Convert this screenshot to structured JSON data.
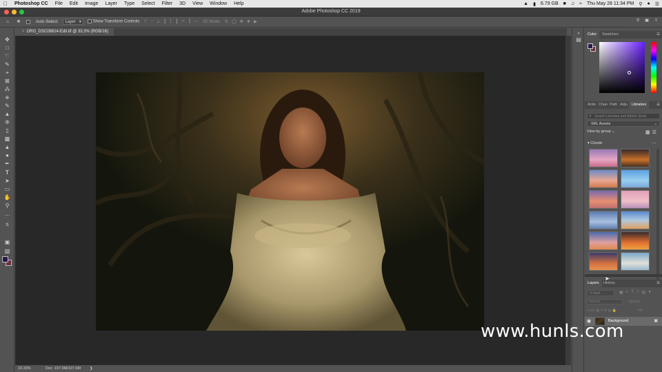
{
  "menubar": {
    "app_name": "Photoshop CC",
    "items": [
      "File",
      "Edit",
      "Image",
      "Layer",
      "Type",
      "Select",
      "Filter",
      "3D",
      "View",
      "Window",
      "Help"
    ],
    "disk": "6.79 GB",
    "clock": "Thu May 28  11:34 PM"
  },
  "window": {
    "title": "Adobe Photoshop CC 2019"
  },
  "options_bar": {
    "auto_select_label": "Auto-Select:",
    "auto_select_value": "Layer",
    "transform_controls_label": "Show Transform Controls",
    "mode_3d_label": "3D Mode:"
  },
  "document": {
    "tab_label": "ORG_DSC08814-Edit.tif @ 33.3% (RGB/16)"
  },
  "status": {
    "zoom": "33.33%",
    "doc_size": "Doc: 197.9M/197.9M"
  },
  "color_panel": {
    "tabs": [
      "Color",
      "Swatches"
    ],
    "foreground": "#2a1a4a",
    "background": "#6e2c3a"
  },
  "libraries_panel": {
    "tabs": [
      "Actio",
      "Chan",
      "Path",
      "Adju",
      "Libraries"
    ],
    "search_placeholder": "Search Libraries and Adobe Stock",
    "library_name": "SRL Assets",
    "view_by": "View by group",
    "group_name": "Clouds",
    "thumbnail_count": 12
  },
  "layers_panel": {
    "tabs": [
      "Layers",
      "History"
    ],
    "filter_placeholder": "Kind",
    "blend_mode": "Normal",
    "opacity_label": "Opacity:",
    "lock_label": "Lock:",
    "fill_label": "Fill:",
    "layers": [
      {
        "name": "Background",
        "visible": true,
        "locked": true
      }
    ]
  },
  "watermark": "www.hunls.com"
}
